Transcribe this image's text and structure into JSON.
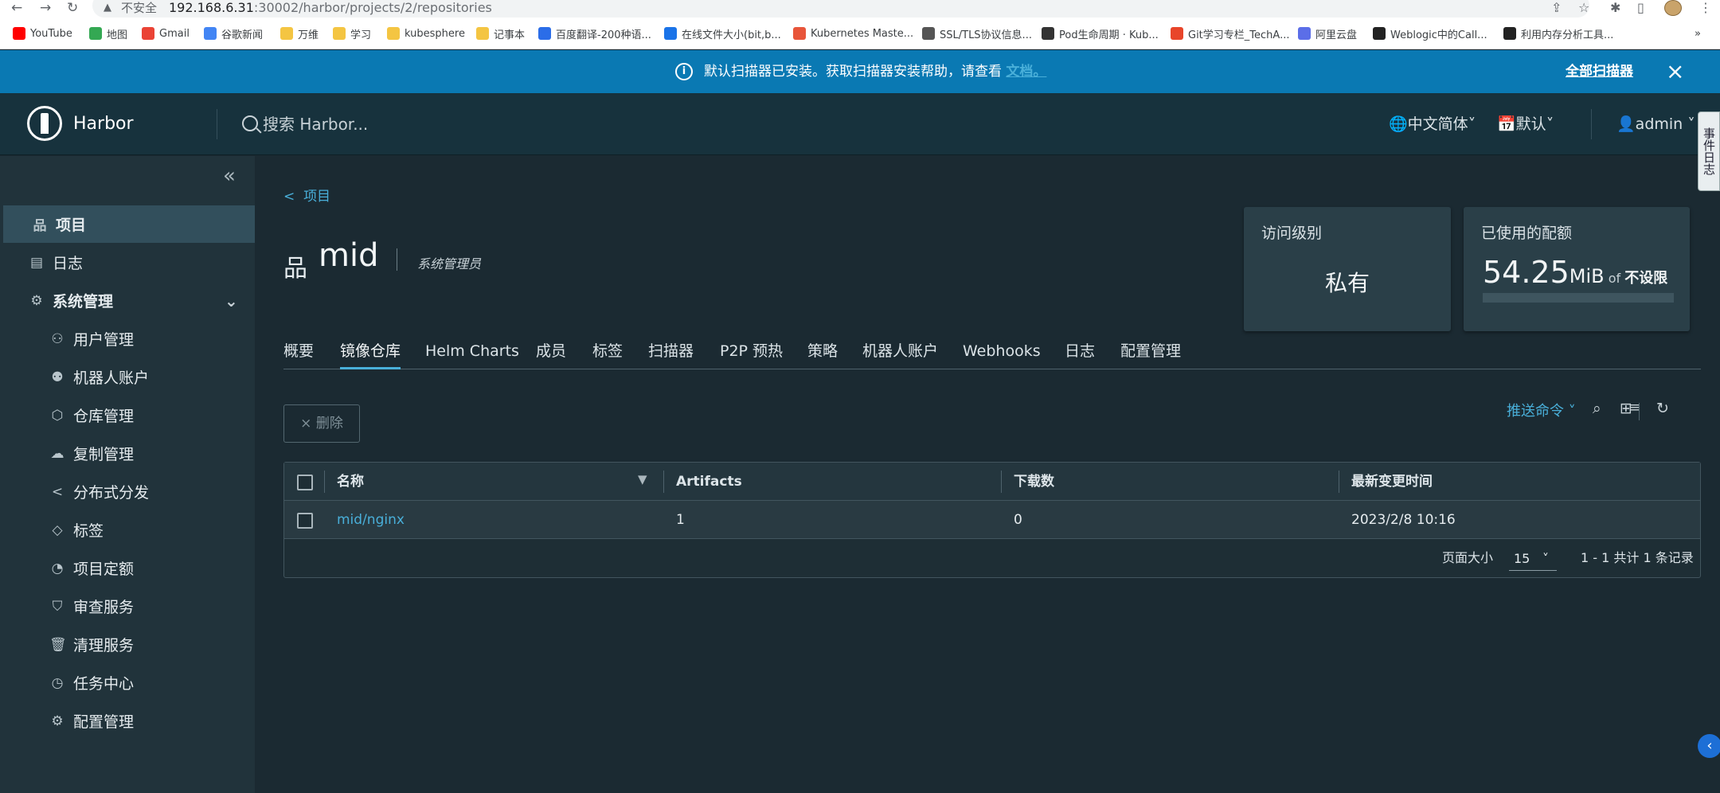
{
  "browser": {
    "security_label": "不安全",
    "url_host": "192.168.6.31",
    "url_path": ":30002/harbor/projects/2/repositories",
    "bookmarks": [
      {
        "label": "YouTube",
        "color": "#ff0000"
      },
      {
        "label": "地图",
        "color": "#34a853"
      },
      {
        "label": "Gmail",
        "color": "#ea4335"
      },
      {
        "label": "谷歌新闻",
        "color": "#4285f4"
      },
      {
        "label": "万维",
        "color": "#f4c542"
      },
      {
        "label": "学习",
        "color": "#f4c542"
      },
      {
        "label": "kubesphere",
        "color": "#f4c542"
      },
      {
        "label": "记事本",
        "color": "#f4c542"
      },
      {
        "label": "百度翻译-200种语...",
        "color": "#2b6de8"
      },
      {
        "label": "在线文件大小(bit,b...",
        "color": "#1a73e8"
      },
      {
        "label": "Kubernetes Maste...",
        "color": "#e8553a"
      },
      {
        "label": "SSL/TLS协议信息...",
        "color": "#555555"
      },
      {
        "label": "Pod生命周期 · Kub...",
        "color": "#333333"
      },
      {
        "label": "Git学习专栏_TechA...",
        "color": "#e8452a"
      },
      {
        "label": "阿里云盘",
        "color": "#5b6ee8"
      },
      {
        "label": "Weblogic中的Call...",
        "color": "#222222"
      },
      {
        "label": "利用内存分析工具...",
        "color": "#222222"
      }
    ]
  },
  "banner": {
    "message": "默认扫描器已安装。获取扫描器安装帮助，请查看 ",
    "doc_link": "文档。",
    "all_scanners": "全部扫描器"
  },
  "header": {
    "brand": "Harbor",
    "search_placeholder": "搜索 Harbor...",
    "language": "中文简体",
    "date_format": "默认",
    "user": "admin",
    "event_tab": "事件日志"
  },
  "sidebar": {
    "items": [
      {
        "label": "项目",
        "icon": "project-icon"
      },
      {
        "label": "日志",
        "icon": "log-icon"
      },
      {
        "label": "系统管理",
        "icon": "admin-icon"
      },
      {
        "label": "用户管理",
        "icon": "users-icon"
      },
      {
        "label": "机器人账户",
        "icon": "robot-icon"
      },
      {
        "label": "仓库管理",
        "icon": "registry-icon"
      },
      {
        "label": "复制管理",
        "icon": "replication-icon"
      },
      {
        "label": "分布式分发",
        "icon": "share-icon"
      },
      {
        "label": "标签",
        "icon": "tag-icon"
      },
      {
        "label": "项目定额",
        "icon": "quota-icon"
      },
      {
        "label": "审查服务",
        "icon": "shield-icon"
      },
      {
        "label": "清理服务",
        "icon": "trash-icon"
      },
      {
        "label": "任务中心",
        "icon": "clock-icon"
      },
      {
        "label": "配置管理",
        "icon": "gear-icon"
      }
    ]
  },
  "page": {
    "breadcrumb": "项目",
    "title": "mid",
    "role": "系统管理员",
    "access_card": {
      "title": "访问级别",
      "value": "私有"
    },
    "quota_card": {
      "title": "已使用的配额",
      "amount": "54.25",
      "unit": "MiB",
      "of": "of",
      "limit": "不设限",
      "fill_fraction": 0
    }
  },
  "tabs": [
    "概要",
    "镜像仓库",
    "Helm Charts",
    "成员",
    "标签",
    "扫描器",
    "P2P 预热",
    "策略",
    "机器人账户",
    "Webhooks",
    "日志",
    "配置管理"
  ],
  "toolbar": {
    "delete_label": "删除",
    "push_command": "推送命令"
  },
  "table": {
    "headers": [
      "名称",
      "Artifacts",
      "下载数",
      "最新变更时间"
    ],
    "rows": [
      {
        "name": "mid/nginx",
        "artifacts": "1",
        "pulls": "0",
        "updated": "2023/2/8 10:16"
      }
    ],
    "footer": {
      "page_size_label": "页面大小",
      "page_size": "15",
      "summary": "1 - 1 共计 1 条记录"
    }
  },
  "colors": {
    "accent": "#49afd9",
    "banner": "#0a79b3",
    "header": "#17323d"
  }
}
